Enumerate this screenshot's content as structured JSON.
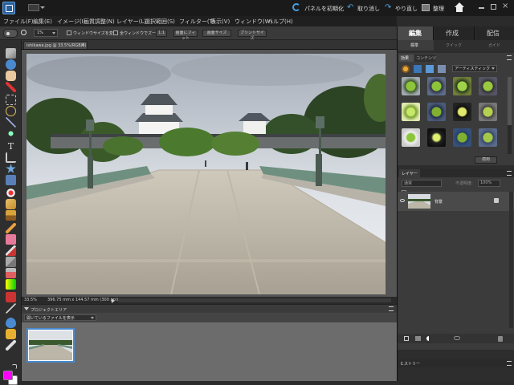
{
  "titlebar": {
    "reset_panels_label": "パネルを初期化",
    "undo_label": "取り消し",
    "redo_label": "やり直し",
    "organize_label": "整理"
  },
  "menu": [
    "ファイル(F)",
    "編集(E)",
    "イメージ(I)",
    "画質調整(N)",
    "レイヤー(L)",
    "選択範囲(S)",
    "フィルター(T)",
    "表示(V)",
    "ウィンドウ(W)",
    "ヘルプ(H)"
  ],
  "options_bar": {
    "zoom_value": "1%",
    "resize_windows_label": "ウィンドウサイズを変更",
    "zoom_all_label": "全ウィンドウでズーム",
    "actual_pixels_label": "1:1",
    "fit_screen_label": "画面にフィット",
    "screen_size_label": "画面サイズ",
    "print_size_label": "プリントサイズ"
  },
  "doc_tab": "ishikawa.jpg @ 33.5%(RGB/8)",
  "status": {
    "zoom": "33.5%",
    "size": "396.75 mm x 144.57 mm (300 ppi)"
  },
  "project_bin": {
    "title": "プロジェクトエリア",
    "dropdown": "開いているファイルを表示"
  },
  "panel_tabs": [
    "編集",
    "作成",
    "配信"
  ],
  "sub_tabs": [
    "標準",
    "クイック",
    "ガイド"
  ],
  "effects": {
    "tab_effects": "効果",
    "tab_content": "コンテンツ",
    "dropdown": "アーティスティック",
    "apply_label": "適用"
  },
  "layers": {
    "title": "レイヤー",
    "blend_mode": "通常",
    "opacity_label": "不透明度:",
    "opacity_value": "100%",
    "layer_name": "背景"
  },
  "history": {
    "title": "ヒストリー"
  },
  "colors": {
    "foreground": "#ff00ff",
    "background": "#ffffff",
    "accent": "#3a82c4"
  }
}
